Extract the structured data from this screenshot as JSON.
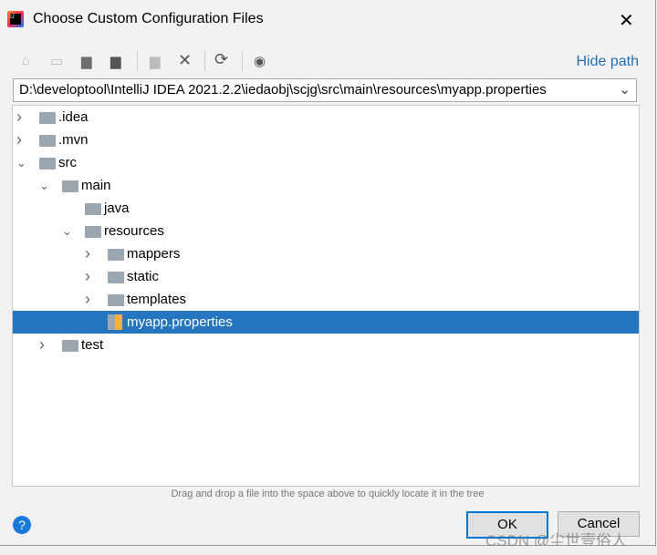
{
  "title": "Choose Custom Configuration Files",
  "toolbar": {
    "icons": [
      "home-icon",
      "desktop-icon",
      "project-folder-icon",
      "module-folder-icon",
      "new-folder-icon",
      "delete-icon",
      "refresh-icon",
      "show-hidden-icon"
    ],
    "hide_path": "Hide path"
  },
  "path": "D:\\developtool\\IntelliJ IDEA 2021.2.2\\iedaobj\\scjg\\src\\main\\resources\\myapp.properties",
  "tree": [
    {
      "label": ".idea",
      "level": 0,
      "state": "collapsed"
    },
    {
      "label": ".mvn",
      "level": 0,
      "state": "collapsed"
    },
    {
      "label": "src",
      "level": 0,
      "state": "expanded"
    },
    {
      "label": "main",
      "level": 1,
      "state": "expanded"
    },
    {
      "label": "java",
      "level": 2,
      "state": "leaf"
    },
    {
      "label": "resources",
      "level": 2,
      "state": "expanded"
    },
    {
      "label": "mappers",
      "level": 3,
      "state": "collapsed"
    },
    {
      "label": "static",
      "level": 3,
      "state": "collapsed"
    },
    {
      "label": "templates",
      "level": 3,
      "state": "collapsed"
    },
    {
      "label": "myapp.properties",
      "level": 3,
      "state": "file",
      "selected": true
    },
    {
      "label": "test",
      "level": 1,
      "state": "collapsed"
    }
  ],
  "hint": "Drag and drop a file into the space above to quickly locate it in the tree",
  "help": "?",
  "ok": "OK",
  "cancel": "Cancel",
  "watermark": "CSDN @尘世壹俗人",
  "accent": "#2675bf"
}
